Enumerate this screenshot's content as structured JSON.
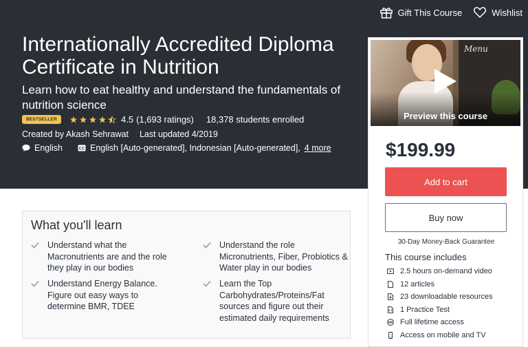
{
  "header": {
    "gift_label": "Gift This Course",
    "wishlist_label": "Wishlist"
  },
  "course": {
    "title": "Internationally Accredited Diploma Certificate in Nutrition",
    "subtitle": "Learn how to eat healthy and understand the fundamentals of nutrition science",
    "badge": "BESTSELLER",
    "rating": "4.5",
    "rating_stars": 4.5,
    "ratings_count": "(1,693 ratings)",
    "students": "18,378 students enrolled",
    "created_by": "Created by Akash Sehrawat",
    "last_updated": "Last updated 4/2019",
    "language": "English",
    "captions": "English [Auto-generated], Indonesian [Auto-generated],",
    "more_link": "4 more"
  },
  "learn": {
    "title": "What you'll learn",
    "items": [
      "Understand what the Macronutrients are and the role they play in our bodies",
      "Understand the role Micronutrients, Fiber, Probiotics & Water play in our bodies",
      "Understand Energy Balance. Figure out easy ways to determine BMR, TDEE",
      "Learn the Top Carbohydrates/Proteins/Fat sources and figure out their estimated daily requirements"
    ]
  },
  "sidebar": {
    "preview_label": "Preview this course",
    "price": "$199.99",
    "add_to_cart": "Add to cart",
    "buy_now": "Buy now",
    "guarantee": "30-Day Money-Back Guarantee",
    "includes_title": "This course includes",
    "includes": [
      {
        "icon": "video-icon",
        "label": "2.5 hours on-demand video"
      },
      {
        "icon": "file-icon",
        "label": "12 articles"
      },
      {
        "icon": "download-icon",
        "label": "23 downloadable resources"
      },
      {
        "icon": "code-icon",
        "label": "1 Practice Test"
      },
      {
        "icon": "infinity-icon",
        "label": "Full lifetime access"
      },
      {
        "icon": "mobile-icon",
        "label": "Access on mobile and TV"
      }
    ]
  },
  "colors": {
    "hero_bg": "#2a2e35",
    "accent_red": "#ec5252",
    "badge_yellow": "#f4c150"
  }
}
